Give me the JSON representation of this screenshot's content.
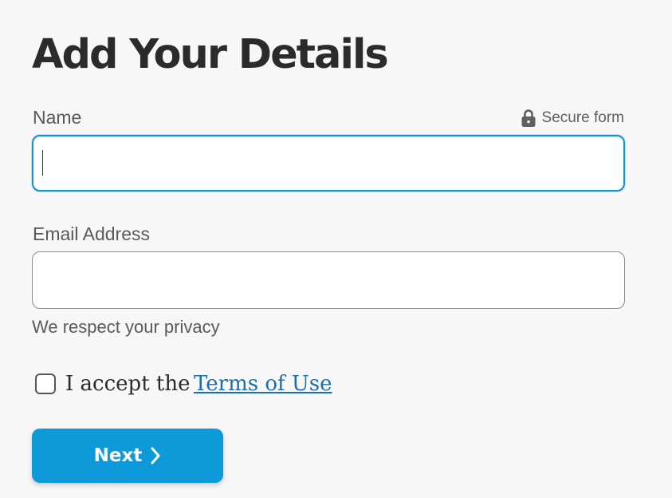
{
  "page": {
    "title": "Add Your Details"
  },
  "form": {
    "secure_label": "Secure form",
    "secure_icon": "lock-icon",
    "name": {
      "label": "Name",
      "value": "",
      "placeholder": "",
      "focused": true
    },
    "email": {
      "label": "Email Address",
      "value": "",
      "placeholder": "",
      "hint": "We respect your privacy"
    },
    "terms": {
      "checked": false,
      "prefix": "I accept the",
      "link_text": "Terms of Use"
    },
    "next_button": {
      "label": "Next",
      "icon": "chevron-right-icon"
    }
  },
  "colors": {
    "accent": "#0e9ad8",
    "focus_border": "#1795d1",
    "link": "#1a6fb0",
    "background": "#f7f7f7"
  }
}
